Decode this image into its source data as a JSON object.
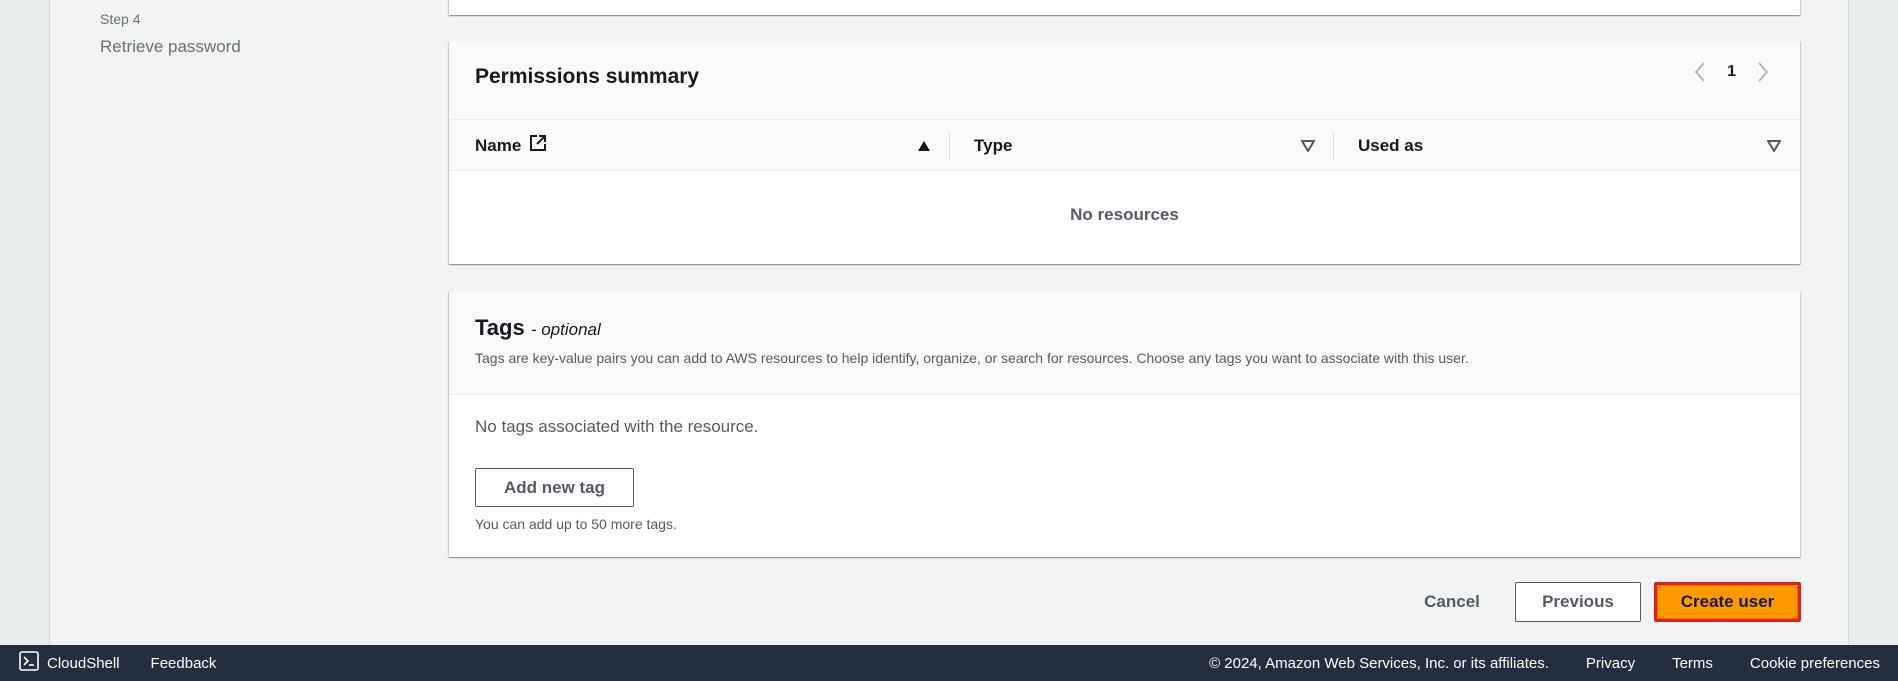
{
  "steps": {
    "current_label": "Step 4",
    "current_title": "Retrieve password"
  },
  "permissions": {
    "title": "Permissions summary",
    "page": "1",
    "columns": [
      {
        "label": "Name"
      },
      {
        "label": "Type"
      },
      {
        "label": "Used as"
      }
    ],
    "empty_text": "No resources"
  },
  "tags": {
    "title": "Tags",
    "optional": "- optional",
    "description": "Tags are key-value pairs you can add to AWS resources to help identify, organize, or search for resources. Choose any tags you want to associate with this user.",
    "empty_text": "No tags associated with the resource.",
    "add_button": "Add new tag",
    "hint": "You can add up to 50 more tags."
  },
  "actions": {
    "cancel": "Cancel",
    "previous": "Previous",
    "create": "Create user"
  },
  "footer": {
    "cloudshell": "CloudShell",
    "feedback": "Feedback",
    "copyright": "© 2024, Amazon Web Services, Inc. or its affiliates.",
    "privacy": "Privacy",
    "terms": "Terms",
    "cookies": "Cookie preferences"
  },
  "colors": {
    "primary_button": "#ff9900",
    "highlight_border": "#e61e1e",
    "footer_bg": "#232f3e"
  }
}
